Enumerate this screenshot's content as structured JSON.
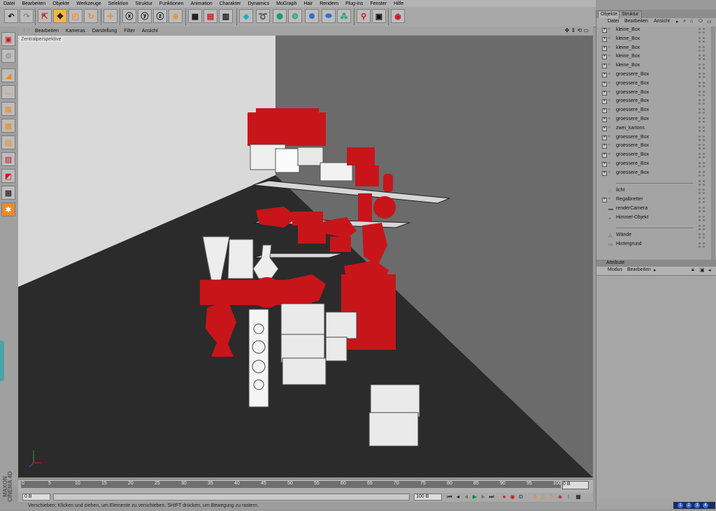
{
  "menubar": [
    "Datei",
    "Bearbeiten",
    "Objekte",
    "Werkzeuge",
    "Selektion",
    "Struktur",
    "Funktionen",
    "Animation",
    "Charakter",
    "Dynamics",
    "MoGraph",
    "Hair",
    "Rendern",
    "Plug-ins",
    "Fenster",
    "Hilfe"
  ],
  "viewport": {
    "menu": [
      "Bearbeiten",
      "Kameras",
      "Darstellung",
      "Filter",
      "Ansicht"
    ],
    "label": "Zentralperspektive",
    "nav_icons": "✥ ⇕ ⟲ ▭"
  },
  "timeline": {
    "ticks": [
      "0",
      "5",
      "10",
      "15",
      "20",
      "25",
      "30",
      "35",
      "40",
      "45",
      "50",
      "55",
      "60",
      "65",
      "70",
      "75",
      "80",
      "85",
      "90",
      "95",
      "100"
    ],
    "current_frame": "0 B",
    "start_field": "0 B",
    "end_field": "100 B",
    "range_field": "0 B"
  },
  "status": "Verschieben: Klicken und ziehen, um Elemente zu verschieben. SHIFT drücken, um Bewegung zu rastern.",
  "branding": {
    "line1": "MAXON",
    "line2": "CINEMA 4D"
  },
  "objects_panel": {
    "tabs": [
      "Objekte",
      "Struktur"
    ],
    "menu": [
      "Datei",
      "Bearbeiten",
      "Ansicht"
    ],
    "rows": [
      {
        "label": "kleine_Box",
        "indent": 1,
        "expand": "+",
        "icon": "null-icon"
      },
      {
        "label": "kleine_Box",
        "indent": 1,
        "expand": "+",
        "icon": "null-icon"
      },
      {
        "label": "kleine_Box",
        "indent": 1,
        "expand": "+",
        "icon": "null-icon"
      },
      {
        "label": "kleine_Box",
        "indent": 1,
        "expand": "+",
        "icon": "null-icon"
      },
      {
        "label": "kleine_Box",
        "indent": 1,
        "expand": "+",
        "icon": "null-icon"
      },
      {
        "label": "groessere_Box",
        "indent": 1,
        "expand": "+",
        "icon": "null-icon"
      },
      {
        "label": "groessere_Box",
        "indent": 1,
        "expand": "+",
        "icon": "null-icon"
      },
      {
        "label": "groessere_Box",
        "indent": 1,
        "expand": "+",
        "icon": "null-icon"
      },
      {
        "label": "groessere_Box",
        "indent": 1,
        "expand": "+",
        "icon": "null-icon"
      },
      {
        "label": "groessere_Box",
        "indent": 1,
        "expand": "+",
        "icon": "null-icon"
      },
      {
        "label": "groessere_Box",
        "indent": 1,
        "expand": "+",
        "icon": "null-icon"
      },
      {
        "label": "zwei_kartons",
        "indent": 1,
        "expand": "+",
        "icon": "null-icon"
      },
      {
        "label": "groessere_Box",
        "indent": 1,
        "expand": "+",
        "icon": "null-icon"
      },
      {
        "label": "groessere_Box",
        "indent": 1,
        "expand": "+",
        "icon": "null-icon"
      },
      {
        "label": "groessere_Box",
        "indent": 1,
        "expand": "+",
        "icon": "null-icon"
      },
      {
        "label": "groessere_Box",
        "indent": 1,
        "expand": "+",
        "icon": "null-icon"
      },
      {
        "label": "groessere_Box",
        "indent": 1,
        "expand": "+",
        "icon": "null-icon"
      },
      {
        "label": "",
        "indent": 0,
        "expand": "",
        "icon": "null-icon",
        "divider": true
      },
      {
        "label": "licht",
        "indent": 0,
        "expand": "",
        "icon": "light-icon"
      },
      {
        "label": "Regalbretter",
        "indent": 0,
        "expand": "+",
        "icon": "null-icon"
      },
      {
        "label": "renderCamera",
        "indent": 0,
        "expand": "",
        "icon": "camera-icon"
      },
      {
        "label": "Himmel-Objekt",
        "indent": 0,
        "expand": "",
        "icon": "sky-icon"
      },
      {
        "label": "",
        "indent": 0,
        "expand": "",
        "icon": "null-icon",
        "divider": true
      },
      {
        "label": "Wände",
        "indent": 0,
        "expand": "",
        "icon": "floor-icon"
      },
      {
        "label": "Hintergrund",
        "indent": 0,
        "expand": "",
        "icon": "background-icon"
      }
    ]
  },
  "attributes_panel": {
    "title": "Attribute",
    "menu": [
      "Modus",
      "Bearbeiten"
    ]
  },
  "taskbar": [
    "1",
    "2",
    "3",
    "4"
  ],
  "colors": {
    "accent_red": "#c8151a",
    "floor": "#2b2b2b",
    "wall_left": "#d9d9d9",
    "wall_back": "#6b6b6b",
    "accent_orange": "#f08a24"
  }
}
